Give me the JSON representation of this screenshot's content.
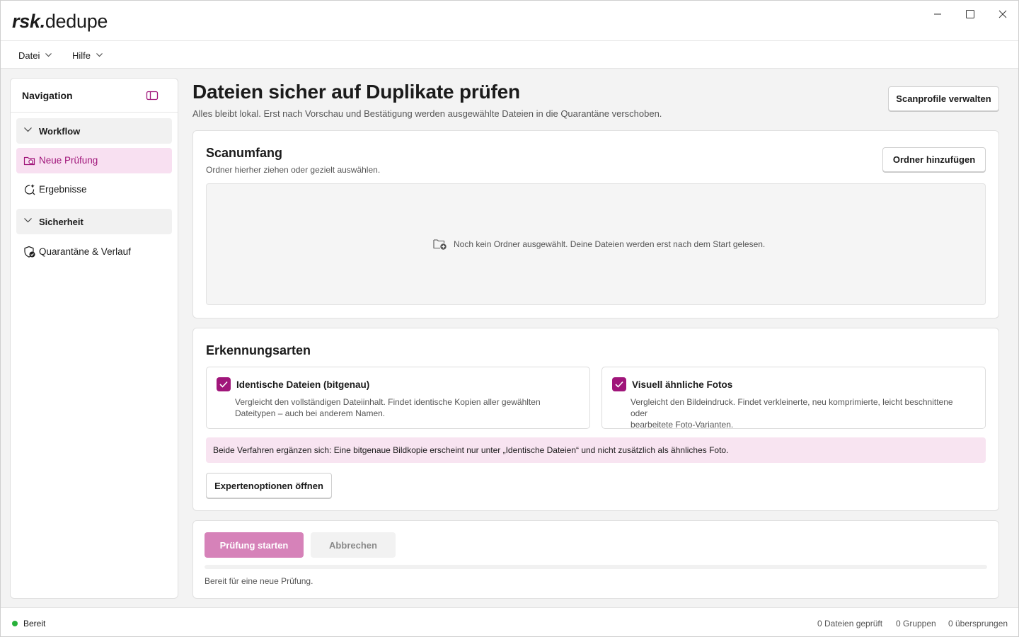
{
  "app": {
    "brand_bold": "rsk.",
    "brand_rest": "dedupe"
  },
  "window_controls": [
    "minimize-icon",
    "maximize-icon",
    "close-icon"
  ],
  "menu": {
    "items": [
      {
        "label": "Datei"
      },
      {
        "label": "Hilfe"
      }
    ]
  },
  "sidebar": {
    "title": "Navigation",
    "groups": [
      {
        "label": "Workflow",
        "expanded": true
      },
      {
        "label": "Sicherheit",
        "expanded": true
      }
    ],
    "items": [
      {
        "label": "Neue Prüfung",
        "icon": "folder-search-icon",
        "active": true
      },
      {
        "label": "Ergebnisse",
        "icon": "sparkle-search-icon",
        "active": false
      },
      {
        "label": "Quarantäne & Verlauf",
        "icon": "shield-check-icon",
        "active": false
      }
    ]
  },
  "header": {
    "title": "Dateien sicher auf Duplikate prüfen",
    "subtitle": "Alles bleibt lokal. Erst nach Vorschau und Bestätigung werden ausgewählte Dateien in die Quarantäne verschoben.",
    "profiles_button": "Scanprofile verwalten"
  },
  "scope": {
    "title": "Scanumfang",
    "subtitle": "Ordner hierher ziehen oder gezielt auswählen.",
    "add_button": "Ordner hinzufügen",
    "empty_text": "Noch kein Ordner ausgewählt. Deine Dateien werden erst nach dem Start gelesen."
  },
  "detection": {
    "title": "Erkennungsarten",
    "options": [
      {
        "title": "Identische Dateien (bitgenau)",
        "checked": true,
        "desc_line1": "Vergleicht den vollständigen Dateiinhalt. Findet identische Kopien aller gewählten",
        "desc_line2": "Dateitypen – auch bei anderem Namen."
      },
      {
        "title": "Visuell ähnliche Fotos",
        "checked": true,
        "desc_line1": "Vergleicht den Bildeindruck. Findet verkleinerte, neu komprimierte, leicht beschnittene oder",
        "desc_line2": "bearbeitete Foto-Varianten."
      }
    ],
    "info": "Beide Verfahren ergänzen sich: Eine bitgenaue Bildkopie erscheint nur unter „Identische Dateien“ und nicht zusätzlich als ähnliches Foto.",
    "expert_button": "Expertenoptionen öffnen"
  },
  "run": {
    "start_button": "Prüfung starten",
    "cancel_button": "Abbrechen",
    "progress": 0,
    "status": "Bereit für eine neue Prüfung."
  },
  "statusbar": {
    "state": "Bereit",
    "files_checked": "0 Dateien geprüft",
    "groups": "0 Gruppen",
    "skipped": "0 übersprungen"
  },
  "colors": {
    "accent": "#a0157a",
    "accent_light": "#f8e0f1",
    "primary_disabled": "#d682b9",
    "status_ok": "#27b13a"
  }
}
